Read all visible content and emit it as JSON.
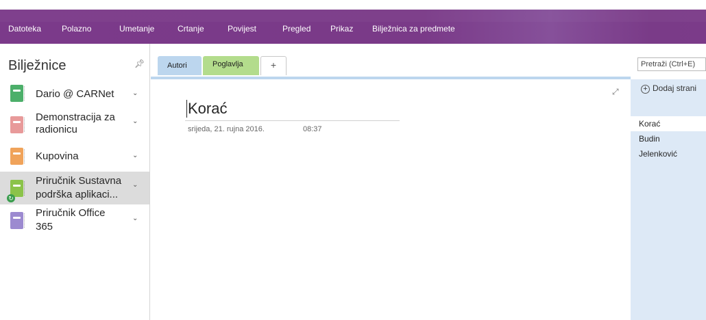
{
  "menu": {
    "items": [
      "Datoteka",
      "Polazno",
      "Umetanje",
      "Crtanje",
      "Povijest",
      "Pregled",
      "Prikaz",
      "Bilježnica za predmete"
    ]
  },
  "notebooks": {
    "title": "Bilježnice",
    "items": [
      {
        "label_line1": "Dario @ CARNet",
        "label_line2": "",
        "color": "#4caf6a"
      },
      {
        "label_line1": "Demonstracija za",
        "label_line2": "radionicu",
        "color": "#e89a9a"
      },
      {
        "label_line1": "Kupovina",
        "label_line2": "",
        "color": "#f0a35a"
      },
      {
        "label_line1": "Priručnik Sustavna",
        "label_line2": "podrška aplikaci...",
        "color": "#8bc34a"
      },
      {
        "label_line1": "Priručnik Office",
        "label_line2": "365",
        "color": "#9c8ad0"
      }
    ]
  },
  "sections": {
    "tabs": [
      "Autori",
      "Poglavlja",
      "+"
    ],
    "active": "Autori"
  },
  "page": {
    "title": "Korać",
    "date": "srijeda, 21. rujna 2016.",
    "time": "08:37"
  },
  "pages_pane": {
    "search_placeholder": "Pretraži (Ctrl+E)",
    "add_page_label": "Dodaj strani",
    "items": [
      "Korać",
      "Budin",
      "Jelenković"
    ]
  }
}
